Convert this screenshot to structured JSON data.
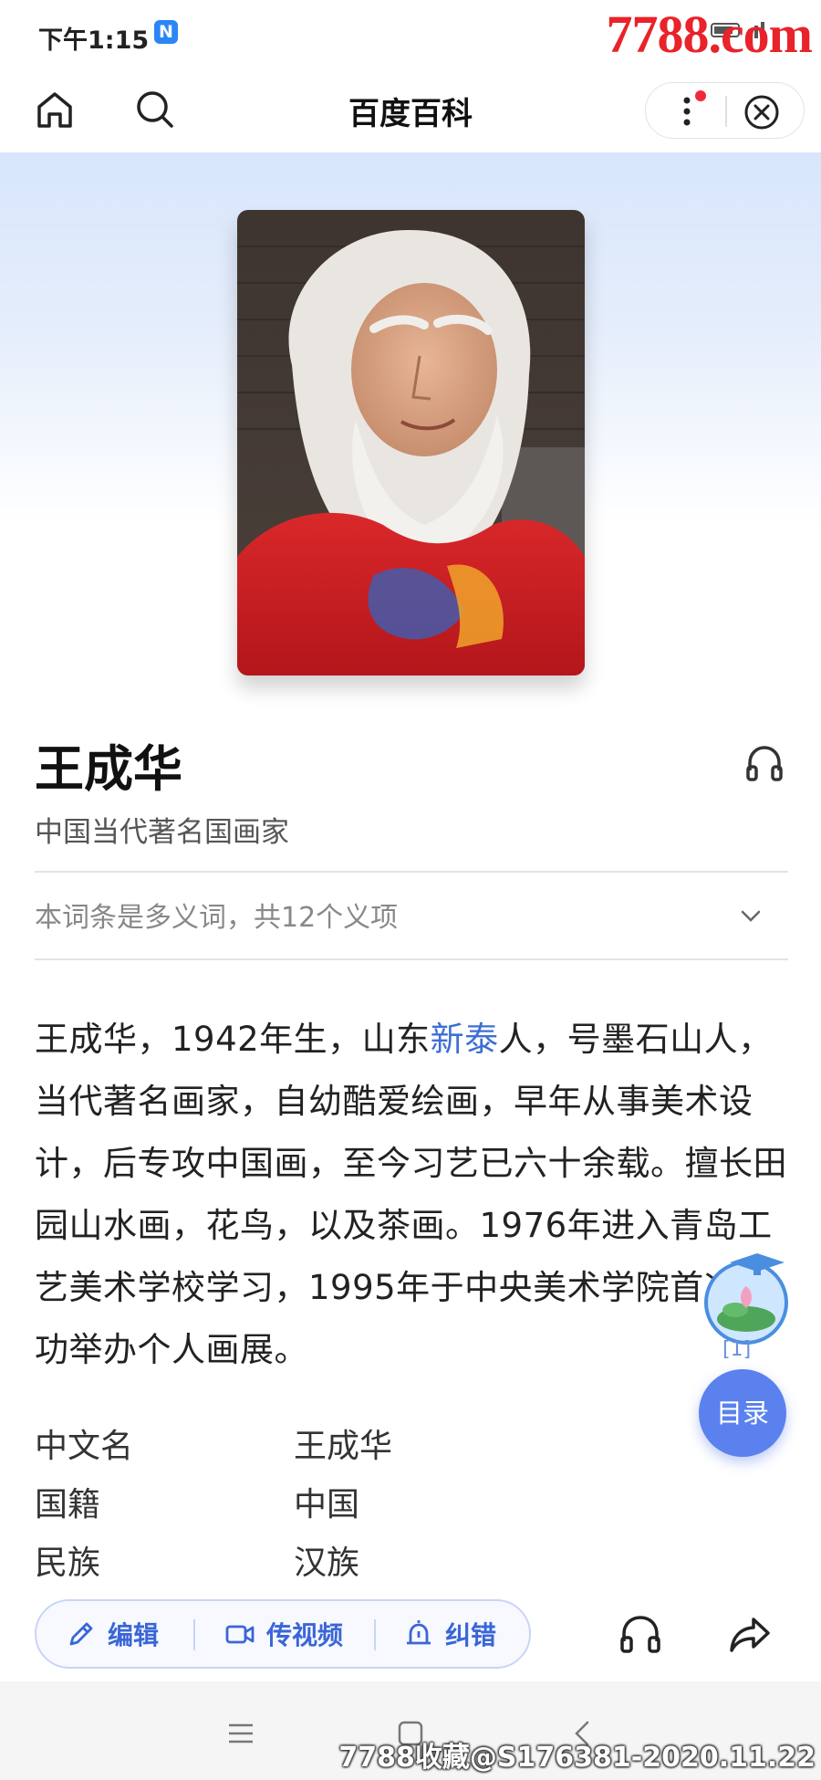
{
  "status_bar": {
    "time": "下午1:15",
    "badge": "N",
    "watermark": "7788.com"
  },
  "nav": {
    "title": "百度百科"
  },
  "entry": {
    "title": "王成华",
    "subtitle": "中国当代著名国画家",
    "polysemy_note": "本词条是多义词，共12个义项"
  },
  "summary": {
    "part1": "王成华，1942年生，山东",
    "link_text": "新泰",
    "part2": "人，号墨石山人，当代著名画家，自幼酷爱绘画，早年从事美术设计，后专攻中国画，至今习艺已六十余载。擅长田园山水画，花鸟，以及茶画。1976年进入青岛工艺美术学校学习，1995年于中央美术学院首次成功举办个人画展。",
    "citation": "[1]"
  },
  "basic_info": [
    {
      "label": "中文名",
      "value": "王成华"
    },
    {
      "label": "国籍",
      "value": "中国"
    },
    {
      "label": "民族",
      "value": "汉族"
    }
  ],
  "floating": {
    "toc_label": "目录"
  },
  "toolbar": {
    "edit_label": "编辑",
    "video_label": "传视频",
    "correct_label": "纠错"
  },
  "footer_watermark": "7788收藏@S176381-2020.11.22",
  "colors": {
    "accent": "#3a66d6",
    "link": "#3d6fd4",
    "toc_button": "#5b81ee",
    "watermark_red": "#e8232a"
  }
}
